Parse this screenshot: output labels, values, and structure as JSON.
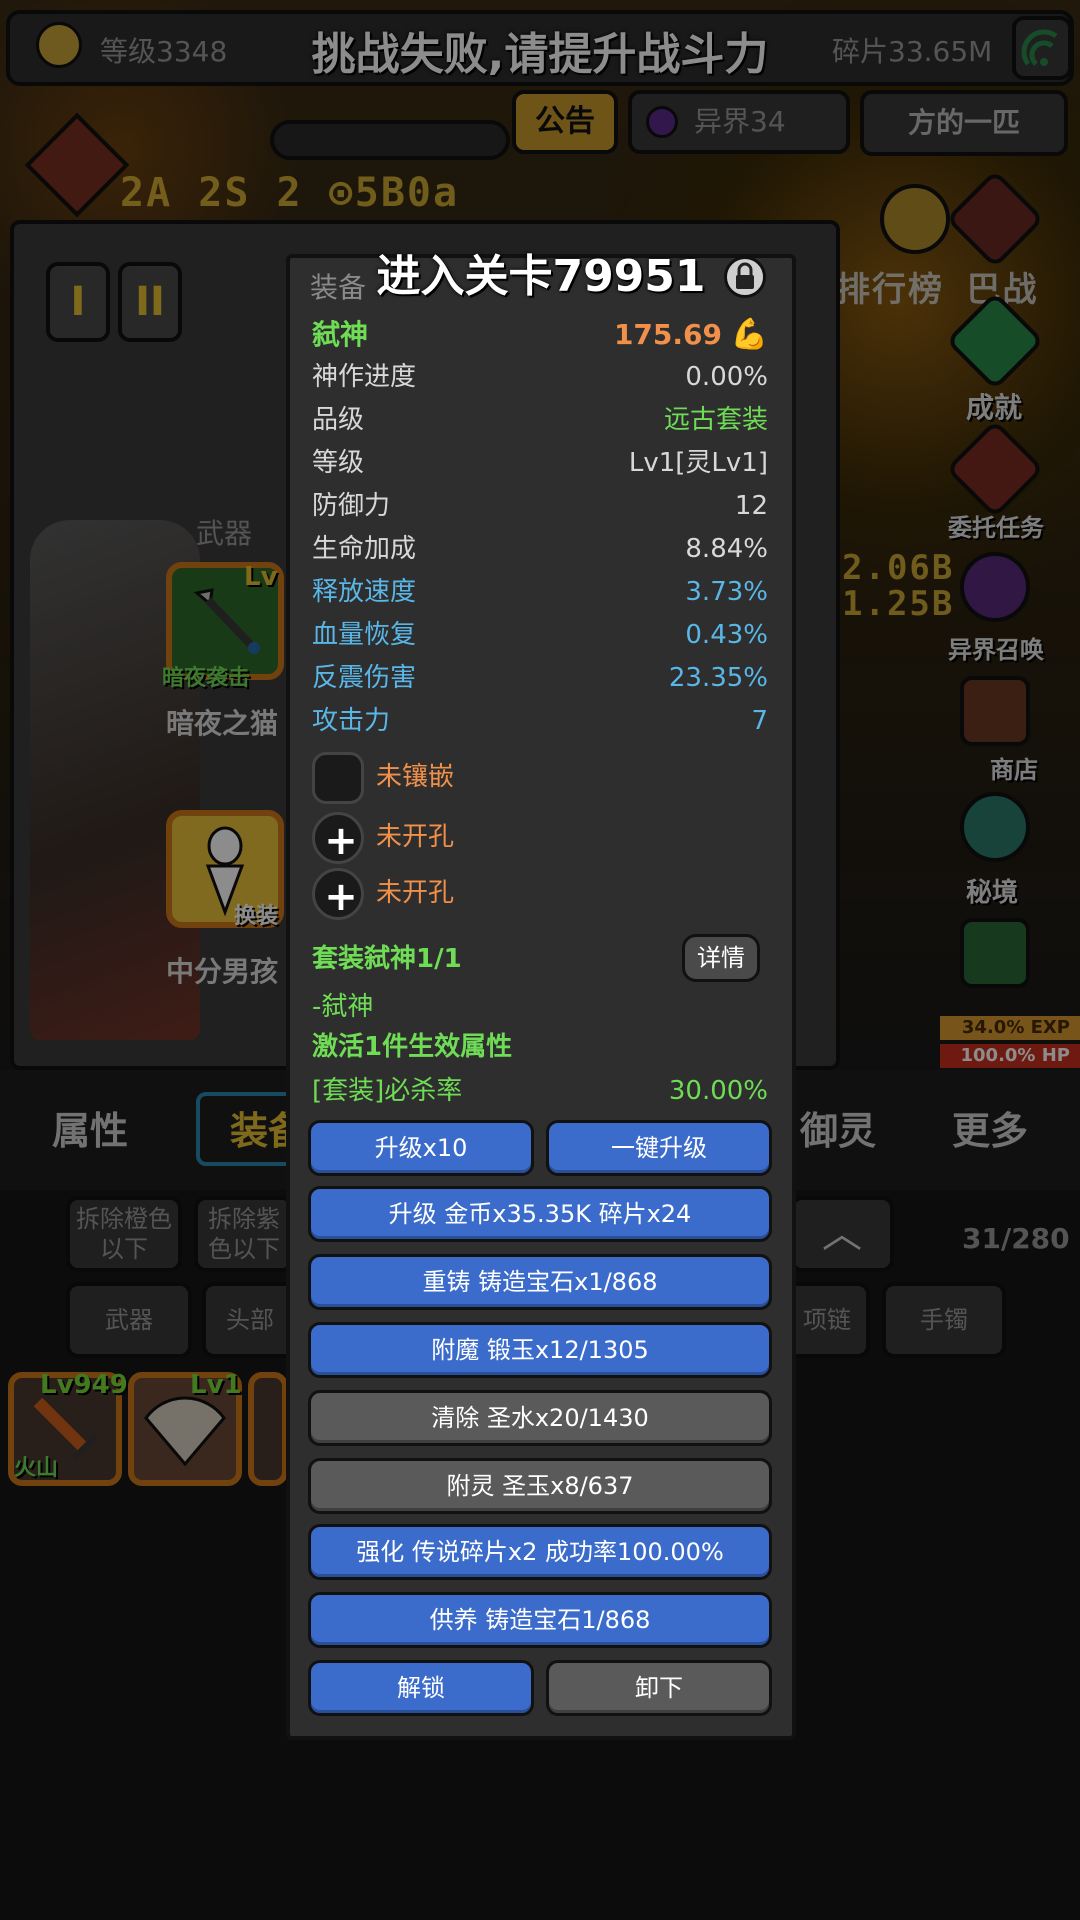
{
  "top": {
    "level": "等级3348",
    "shards": "碎片33.65M",
    "toast": "挑战失败,请提升战斗力",
    "notice": "公告",
    "otherworld": "异界34",
    "top_right": "方的一匹"
  },
  "background": {
    "chars": [
      "2A 2S 2 ⊙5B0a",
      "排行榜 巴战",
      "2.06B",
      "1.25B"
    ]
  },
  "equip_panel": {
    "tabs": [
      "I",
      "II"
    ],
    "weapon_header": "武器",
    "weapon_slot_lv": "Lv",
    "weapon_skill": "暗夜袭击",
    "weapon_name": "暗夜之猫",
    "char_slot_label": "换装",
    "char_name": "中分男孩"
  },
  "side_menu": {
    "achievement": "成就",
    "commission": "委托任务",
    "summon": "异界召唤",
    "shop": "商店",
    "secret": "秘境",
    "exp": "34.0% EXP",
    "hp": "100.0%  HP"
  },
  "bottom_tabs": [
    "属性",
    "装备",
    "御灵",
    "更多"
  ],
  "filters": {
    "remove_orange": "拆除橙色以下",
    "remove_purple": "拆除紫色以下",
    "count": "31/280",
    "categories": [
      "武器",
      "头部",
      "项链",
      "手镯"
    ]
  },
  "inventory": [
    {
      "lv": "Lv949",
      "tag": "火山"
    },
    {
      "lv": "Lv1",
      "tag": ""
    }
  ],
  "detail": {
    "header": "装备",
    "stage_text": "进入关卡79951",
    "name": "弑神",
    "power": "175.69",
    "stats": [
      {
        "k": "神作进度",
        "v": "0.00%",
        "kc": "grey",
        "vc": "grey"
      },
      {
        "k": "品级",
        "v": "远古套装",
        "kc": "grey",
        "vc": "green"
      },
      {
        "k": "等级",
        "v": "Lv1[灵Lv1]",
        "kc": "grey",
        "vc": "grey"
      },
      {
        "k": "防御力",
        "v": "12",
        "kc": "grey",
        "vc": "grey"
      },
      {
        "k": "生命加成",
        "v": "8.84%",
        "kc": "grey",
        "vc": "grey"
      },
      {
        "k": "释放速度",
        "v": "3.73%",
        "kc": "blue",
        "vc": "blue"
      },
      {
        "k": "血量恢复",
        "v": "0.43%",
        "kc": "blue",
        "vc": "blue"
      },
      {
        "k": "反震伤害",
        "v": "23.35%",
        "kc": "blue",
        "vc": "blue"
      },
      {
        "k": "攻击力",
        "v": "7",
        "kc": "blue",
        "vc": "blue"
      }
    ],
    "sockets": [
      "未镶嵌",
      "未开孔",
      "未开孔"
    ],
    "set_title": "套装弑神1/1",
    "details_button": "详情",
    "set_member": "-弑神",
    "activate": "激活1件生效属性",
    "set_bonus_k": "[套装]必杀率",
    "set_bonus_v": "30.00%",
    "buttons": {
      "upgrade10": "升级x10",
      "one_key": "一键升级",
      "upgrade": "升级 金币x35.35K 碎片x24",
      "recast": "重铸 铸造宝石x1/868",
      "enchant": "附魔 锻玉x12/1305",
      "clear": "清除 圣水x20/1430",
      "spirit": "附灵 圣玉x8/637",
      "strengthen": "强化 传说碎片x2 成功率100.00%",
      "nurture": "供养 铸造宝石1/868",
      "unlock": "解锁",
      "unequip": "卸下"
    }
  }
}
